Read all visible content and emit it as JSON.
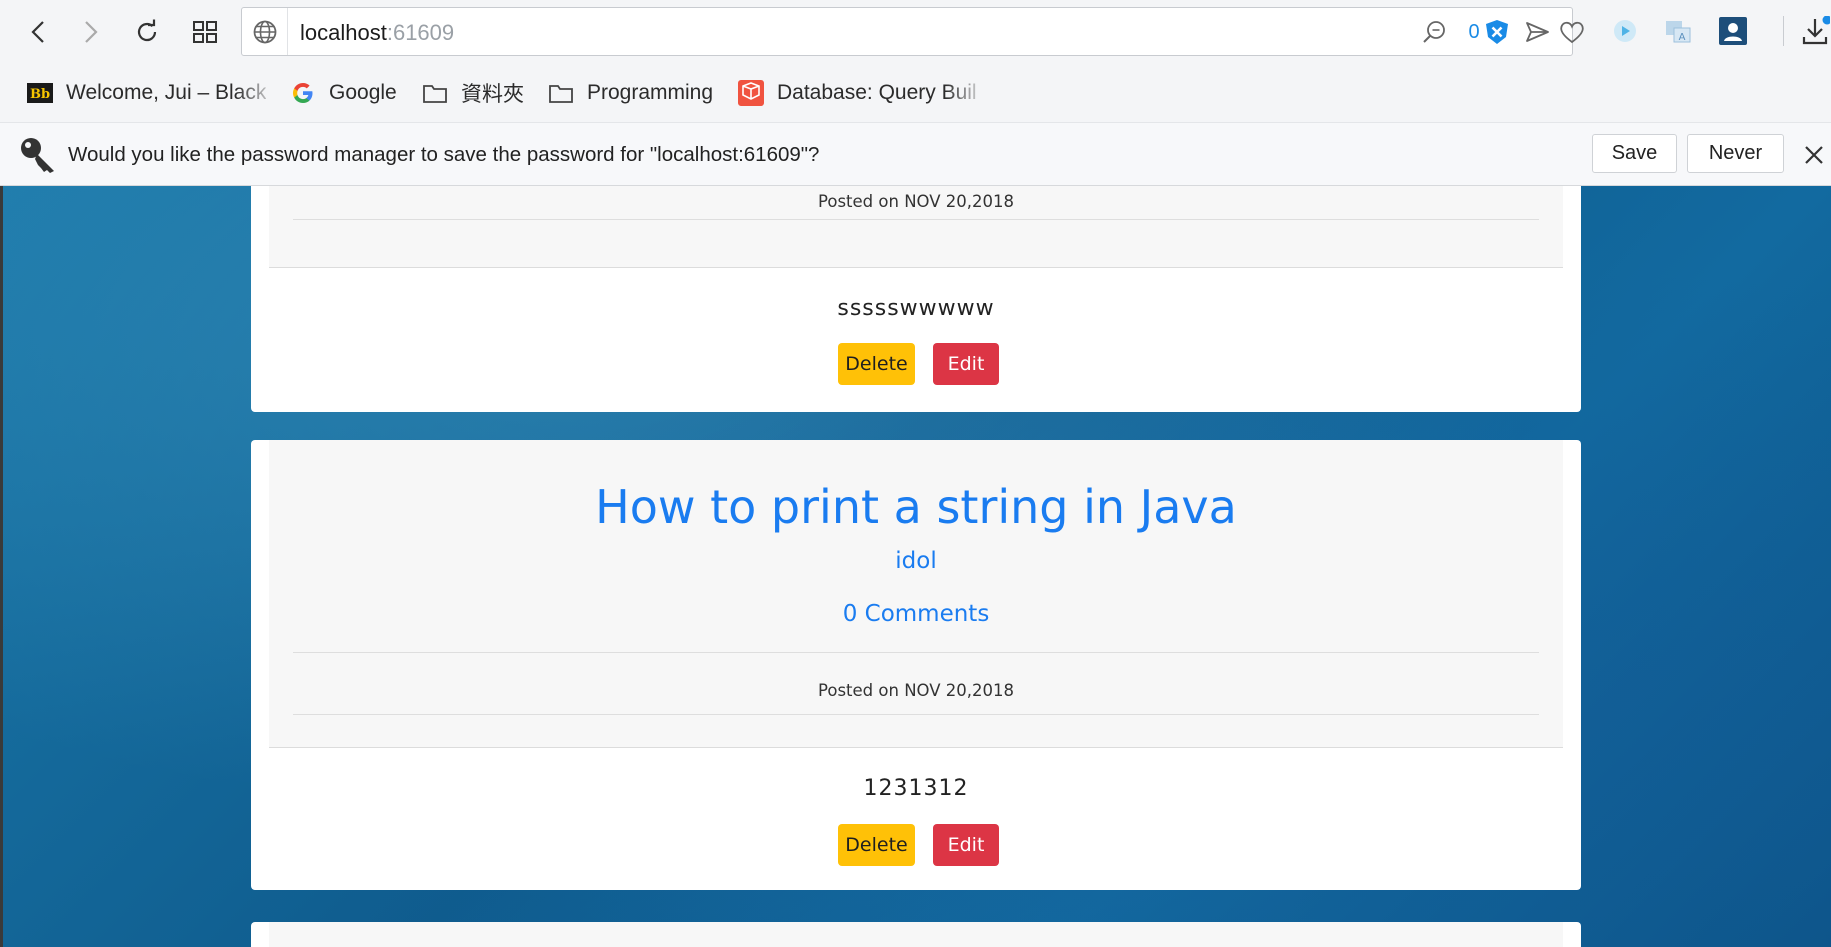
{
  "browser": {
    "address": {
      "host": "localhost",
      "port": ":61609"
    },
    "block_counter": "0",
    "bookmarks": [
      {
        "label": "Welcome, Jui – Blackb",
        "icon": "blackboard-icon"
      },
      {
        "label": "Google",
        "icon": "google-icon"
      },
      {
        "label": "資料夾",
        "icon": "folder-icon"
      },
      {
        "label": "Programming",
        "icon": "folder-icon"
      },
      {
        "label": "Database: Query Builc",
        "icon": "laravel-icon"
      }
    ],
    "password_bar": {
      "message": "Would you like the password manager to save the password for \"localhost:61609\"?",
      "save_label": "Save",
      "never_label": "Never"
    }
  },
  "posts": [
    {
      "posted": "Posted on NOV 20,2018",
      "body": "ssssswwwww",
      "delete_label": "Delete",
      "edit_label": "Edit"
    },
    {
      "title": "How to print a string in Java",
      "author": "idol",
      "comments": "0 Comments",
      "posted": "Posted on NOV 20,2018",
      "body": "1231312",
      "delete_label": "Delete",
      "edit_label": "Edit"
    }
  ],
  "colors": {
    "link": "#1a7cf0",
    "delete": "#ffc107",
    "edit": "#dc3545",
    "background": "#0f5c8e"
  }
}
